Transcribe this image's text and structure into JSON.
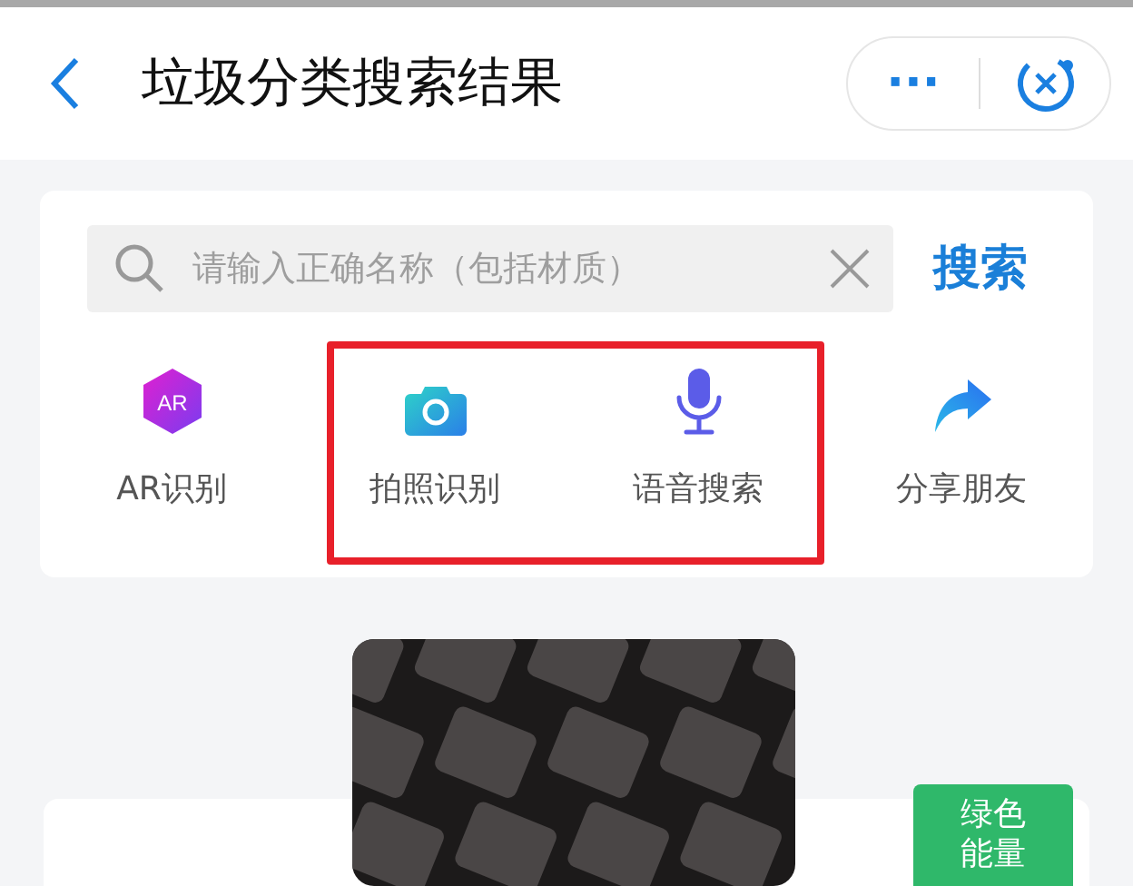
{
  "header": {
    "title": "垃圾分类搜索结果",
    "more": "···"
  },
  "search": {
    "placeholder": "请输入正确名称（包括材质）",
    "button": "搜索"
  },
  "actions": [
    {
      "kind": "ar",
      "label": "AR识别",
      "badge": "AR",
      "highlighted": false
    },
    {
      "kind": "camera",
      "label": "拍照识别",
      "highlighted": true
    },
    {
      "kind": "mic",
      "label": "语音搜索",
      "highlighted": true
    },
    {
      "kind": "share",
      "label": "分享朋友",
      "highlighted": false
    }
  ],
  "result": {
    "badge": [
      "绿色",
      "能量"
    ]
  }
}
